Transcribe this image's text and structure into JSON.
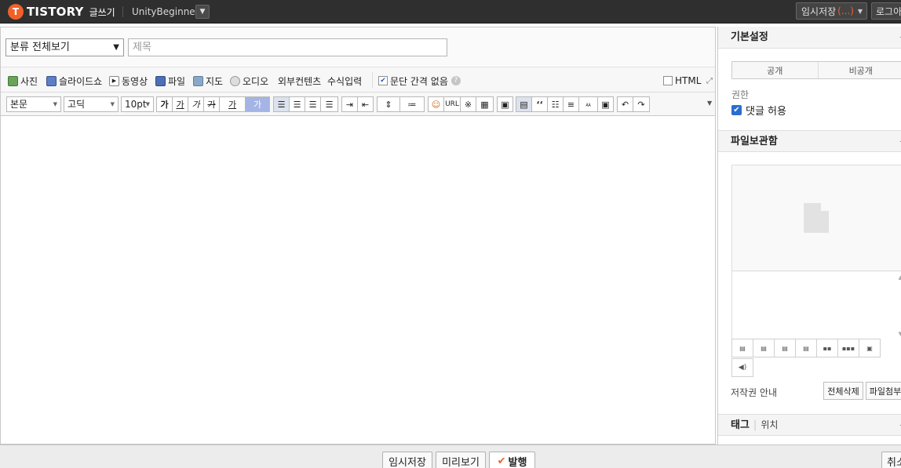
{
  "topbar": {
    "logo_mark": "T",
    "logo_text": "TISTORY",
    "logo_sub": "글쓰기",
    "blog_name": "UnityBeginner",
    "draft_label": "임시저장",
    "draft_status": "(...)",
    "login_label": "로그아웃"
  },
  "editor": {
    "category": "분류 전체보기",
    "title_placeholder": "제목",
    "media": {
      "photo": "사진",
      "slideshow": "슬라이드쇼",
      "video": "동영상",
      "file": "파일",
      "map": "지도",
      "audio": "오디오",
      "external": "외부컨텐츠",
      "formula": "수식입력",
      "no_paragraph_gap": "문단 간격 없음",
      "html": "HTML"
    },
    "format": {
      "block_style": "본문",
      "font": "고딕",
      "size": "10pt",
      "bold": "가",
      "underline": "가",
      "italic": "가",
      "strike": "가",
      "font_color": "가",
      "bg_color": "가",
      "url": "URL",
      "asterisk": "※",
      "quote": "‘‘",
      "special": "ㅆ"
    }
  },
  "sidebar": {
    "basic_settings": "기본설정",
    "public": "공개",
    "private": "비공개",
    "permission_label": "권한",
    "allow_comments": "댓글 허용",
    "file_storage": "파일보관함",
    "copyright_label": "저작권 안내",
    "delete_all": "전체삭제",
    "attach_file": "파일첨부",
    "tag": "태그",
    "location": "위치"
  },
  "bottombar": {
    "draft": "임시저장",
    "preview": "미리보기",
    "publish": "발행",
    "cancel": "취소"
  },
  "colors": {
    "topbar_bg": "#2f2f2f",
    "accent": "#f2602a",
    "highlight": "#a4b4e4"
  }
}
